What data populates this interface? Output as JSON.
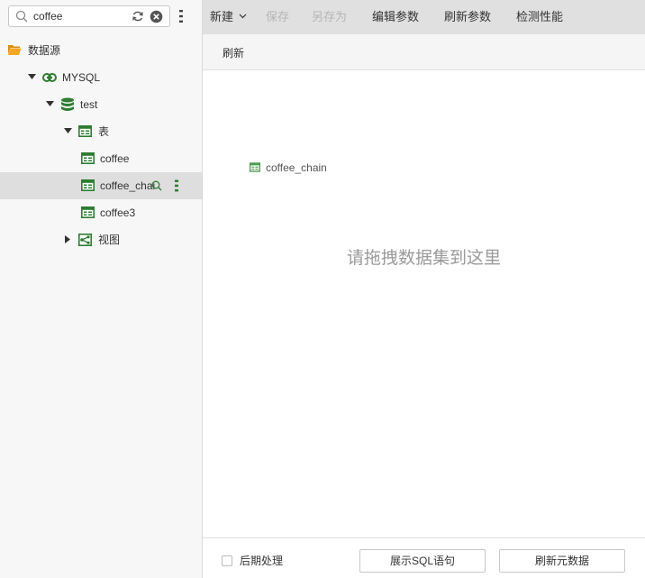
{
  "search": {
    "value": "coffee"
  },
  "tree": {
    "root_label": "数据源",
    "connection_label": "MYSQL",
    "database_label": "test",
    "tables_folder_label": "表",
    "tables": [
      "coffee",
      "coffee_chain",
      "coffee3"
    ],
    "selected_table_display": "coffee_chai",
    "views_folder_label": "视图"
  },
  "toolbar": {
    "new_label": "新建",
    "save_label": "保存",
    "save_as_label": "另存为",
    "edit_params_label": "编辑参数",
    "refresh_params_label": "刷新参数",
    "check_performance_label": "检测性能"
  },
  "subbar": {
    "refresh_label": "刷新"
  },
  "canvas": {
    "node_label": "coffee_chain",
    "drop_hint": "请拖拽数据集到这里"
  },
  "bottom": {
    "post_process_label": "后期处理",
    "show_sql_label": "展示SQL语句",
    "refresh_metadata_label": "刷新元数据"
  },
  "colors": {
    "icon_green": "#2e7d32",
    "folder_orange": "#f5a623",
    "toolbar_bg": "#e0e0e0",
    "selected_row_bg": "#dedede",
    "disabled_text": "#b5b5b5"
  }
}
